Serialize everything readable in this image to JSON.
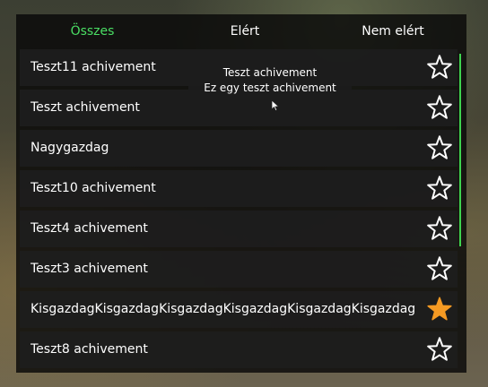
{
  "tabs": [
    {
      "label": "Összes",
      "active": true
    },
    {
      "label": "Elért",
      "active": false
    },
    {
      "label": "Nem elért",
      "active": false
    }
  ],
  "achievements": [
    {
      "label": "Teszt11 achivement",
      "achieved": false
    },
    {
      "label": "Teszt achivement",
      "achieved": false
    },
    {
      "label": "Nagygazdag",
      "achieved": false
    },
    {
      "label": "Teszt10 achivement",
      "achieved": false
    },
    {
      "label": "Teszt4 achivement",
      "achieved": false
    },
    {
      "label": "Teszt3 achivement",
      "achieved": false
    },
    {
      "label": "KisgazdagKisgazdagKisgazdagKisgazdagKisgazdagKisgazdag",
      "achieved": true
    },
    {
      "label": "Teszt8 achivement",
      "achieved": false
    }
  ],
  "tooltip": {
    "title": "Teszt achivement",
    "description": "Ez egy teszt achivement"
  },
  "icons": {
    "achieved": "filled-star-icon",
    "not_achieved": "outline-star-icon",
    "cursor": "mouse-cursor-icon"
  },
  "colors": {
    "active_tab": "#4ade64",
    "achieved_star": "#f59a23",
    "scrollbar": "#3fd44f"
  }
}
